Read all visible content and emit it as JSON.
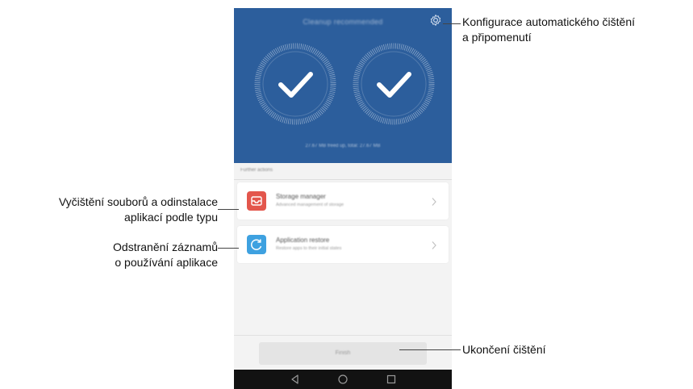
{
  "screen": {
    "title": "Cleanup recommended",
    "status_text": "27.67 MB freed up, total: 27.67 MB",
    "section_title": "Further actions",
    "colors": {
      "header": "#2c5e9c",
      "storage_icon": "#e3564c",
      "restore_icon": "#3ea1e0"
    }
  },
  "items": [
    {
      "title": "Storage manager",
      "subtitle": "Advanced management of storage",
      "icon": "inbox-icon"
    },
    {
      "title": "Application restore",
      "subtitle": "Restore apps to their initial states",
      "icon": "refresh-icon"
    }
  ],
  "finish_label": "Finish",
  "navbar": {
    "icons": [
      "back-icon",
      "home-icon",
      "recent-apps-icon"
    ]
  },
  "callouts": {
    "settings_line1": "Konfigurace automatického čištění",
    "settings_line2": "a připomenutí",
    "storage_line1": "Vyčištění souborů a odinstalace",
    "storage_line2": "aplikací podle typu",
    "restore_line1": "Odstranění záznamů",
    "restore_line2": "o používání aplikace",
    "finish": "Ukončení čištění"
  }
}
